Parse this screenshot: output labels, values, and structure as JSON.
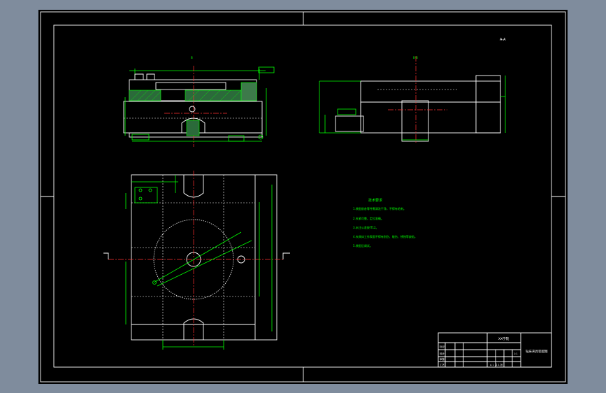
{
  "drawing": {
    "scale_note": "A-A",
    "section_label_top": "B",
    "section_label_right": "B-B",
    "tech_title": "技术要求",
    "tech_notes": [
      "1.装配前各零件需清洗干净，不得有毛刺。",
      "2.夹紧可靠，定位准确。",
      "3.未注公差按IT12。",
      "4.夹具体工作表面不得有划伤、碰伤、锈蚀等缺陷。",
      "5.装配后调试。"
    ],
    "title_block": {
      "part_name": "钻床夹具装配图",
      "design_org": "XX学院",
      "row_labels": [
        "标记",
        "设计",
        "审核",
        "工艺"
      ],
      "sheet": "1:1",
      "footer": "A 1  共 1 张"
    }
  },
  "colors": {
    "background": "#000000",
    "frame": "#ffffff",
    "dimension": "#00ff00",
    "centerline": "#ff3030",
    "hatch": "#00ff00"
  }
}
